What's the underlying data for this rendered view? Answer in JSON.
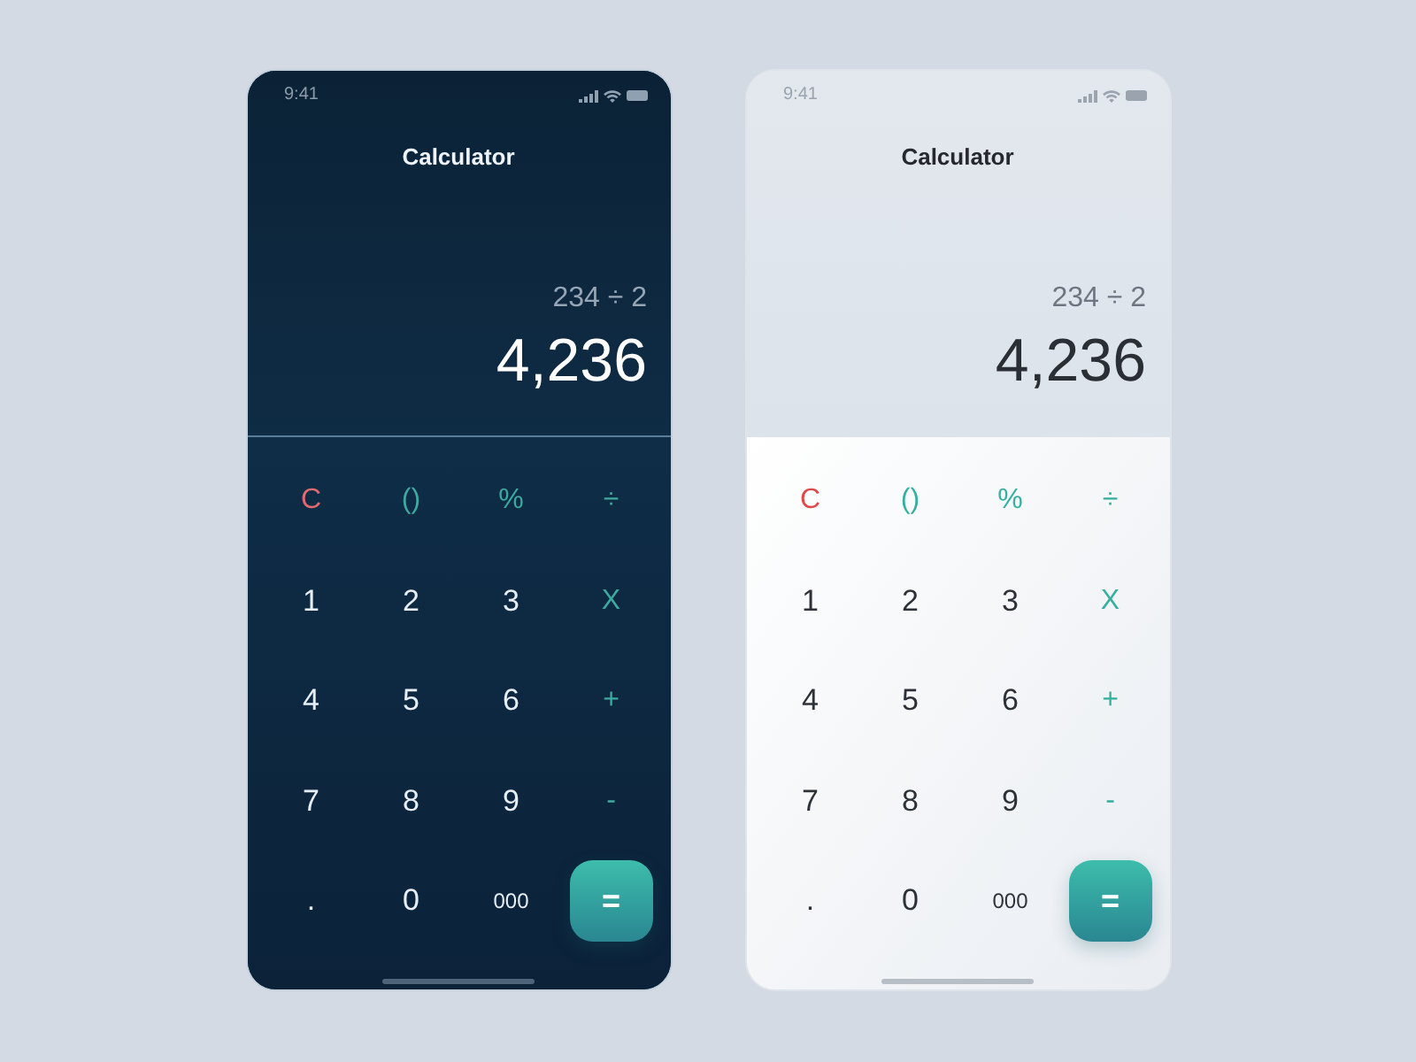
{
  "phones": [
    {
      "kind": "dark",
      "status_bar": {
        "time": "9:41"
      },
      "title": "Calculator",
      "expression": "234 ÷ 2",
      "result": "4,236",
      "keys": [
        {
          "label": "C",
          "kind": "clear"
        },
        {
          "label": "()",
          "kind": "operator"
        },
        {
          "label": "%",
          "kind": "operator"
        },
        {
          "label": "÷",
          "kind": "operator"
        },
        {
          "label": "1",
          "kind": "digit"
        },
        {
          "label": "2",
          "kind": "digit"
        },
        {
          "label": "3",
          "kind": "digit"
        },
        {
          "label": "X",
          "kind": "operator"
        },
        {
          "label": "4",
          "kind": "digit"
        },
        {
          "label": "5",
          "kind": "digit"
        },
        {
          "label": "6",
          "kind": "digit"
        },
        {
          "label": "+",
          "kind": "operator"
        },
        {
          "label": "7",
          "kind": "digit"
        },
        {
          "label": "8",
          "kind": "digit"
        },
        {
          "label": "9",
          "kind": "digit"
        },
        {
          "label": "-",
          "kind": "operator"
        },
        {
          "label": ".",
          "kind": "digit"
        },
        {
          "label": "0",
          "kind": "digit"
        },
        {
          "label": "000",
          "kind": "zeros"
        },
        {
          "label": "=",
          "kind": "equals"
        }
      ]
    },
    {
      "kind": "light",
      "status_bar": {
        "time": "9:41"
      },
      "title": "Calculator",
      "expression": "234 ÷ 2",
      "result": "4,236",
      "keys": [
        {
          "label": "C",
          "kind": "clear"
        },
        {
          "label": "()",
          "kind": "operator"
        },
        {
          "label": "%",
          "kind": "operator"
        },
        {
          "label": "÷",
          "kind": "operator"
        },
        {
          "label": "1",
          "kind": "digit"
        },
        {
          "label": "2",
          "kind": "digit"
        },
        {
          "label": "3",
          "kind": "digit"
        },
        {
          "label": "X",
          "kind": "operator"
        },
        {
          "label": "4",
          "kind": "digit"
        },
        {
          "label": "5",
          "kind": "digit"
        },
        {
          "label": "6",
          "kind": "digit"
        },
        {
          "label": "+",
          "kind": "operator"
        },
        {
          "label": "7",
          "kind": "digit"
        },
        {
          "label": "8",
          "kind": "digit"
        },
        {
          "label": "9",
          "kind": "digit"
        },
        {
          "label": "-",
          "kind": "operator"
        },
        {
          "label": ".",
          "kind": "digit"
        },
        {
          "label": "0",
          "kind": "digit"
        },
        {
          "label": "000",
          "kind": "zeros"
        },
        {
          "label": "=",
          "kind": "equals"
        }
      ]
    }
  ]
}
